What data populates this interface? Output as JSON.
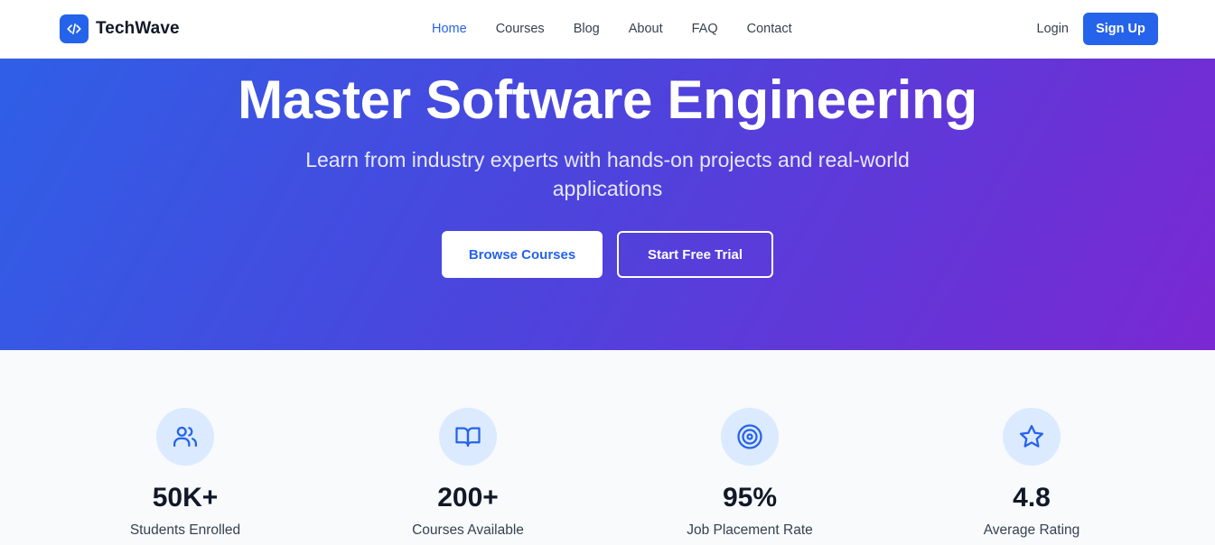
{
  "brand": {
    "name": "TechWave",
    "icon": "code-icon",
    "color": "#2563eb"
  },
  "nav": {
    "links": [
      {
        "label": "Home",
        "active": true
      },
      {
        "label": "Courses",
        "active": false
      },
      {
        "label": "Blog",
        "active": false
      },
      {
        "label": "About",
        "active": false
      },
      {
        "label": "FAQ",
        "active": false
      },
      {
        "label": "Contact",
        "active": false
      }
    ],
    "login_label": "Login",
    "signup_label": "Sign Up"
  },
  "hero": {
    "title": "Master Software Engineering",
    "subtitle": "Learn from industry experts with hands-on projects and real-world applications",
    "primary_cta": "Browse Courses",
    "secondary_cta": "Start Free Trial",
    "gradient_start": "#2f5fe6",
    "gradient_end": "#7a28d2"
  },
  "stats": [
    {
      "icon": "users-icon",
      "value": "50K+",
      "label": "Students Enrolled"
    },
    {
      "icon": "book-open-icon",
      "value": "200+",
      "label": "Courses Available"
    },
    {
      "icon": "target-icon",
      "value": "95%",
      "label": "Job Placement Rate"
    },
    {
      "icon": "star-icon",
      "value": "4.8",
      "label": "Average Rating"
    }
  ]
}
